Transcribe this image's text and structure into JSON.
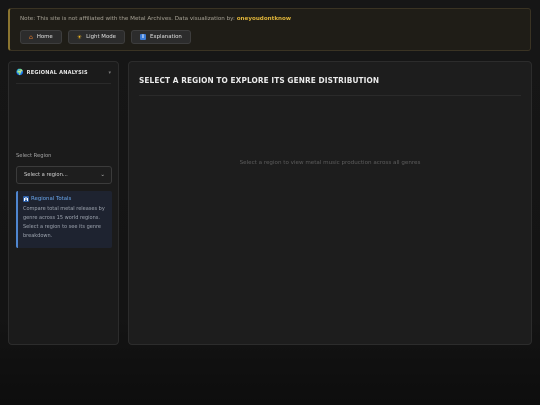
{
  "notice": {
    "text": "Note: This site is not affiliated with the Metal Archives. Data visualization by:",
    "author": "oneyoudontknow"
  },
  "nav_buttons": [
    {
      "icon": "home-icon",
      "label": "Home"
    },
    {
      "icon": "sun-icon",
      "label": "Light Mode"
    },
    {
      "icon": "info-icon",
      "label": "Explanation"
    }
  ],
  "sidebar": {
    "title": "REGIONAL ANALYSIS",
    "select_label": "Select Region",
    "select_value": "Select a region...",
    "info": {
      "title": "Regional Totals",
      "body": "Compare total metal releases by genre across 15 world regions. Select a region to see its genre breakdown."
    }
  },
  "main": {
    "title": "SELECT A REGION TO EXPLORE ITS GENRE DISTRIBUTION",
    "placeholder": "Select a region to view metal music production across all genres"
  },
  "colors": {
    "accent": "#e0b53a",
    "info_accent": "#4f86cf",
    "background": "#151515"
  }
}
